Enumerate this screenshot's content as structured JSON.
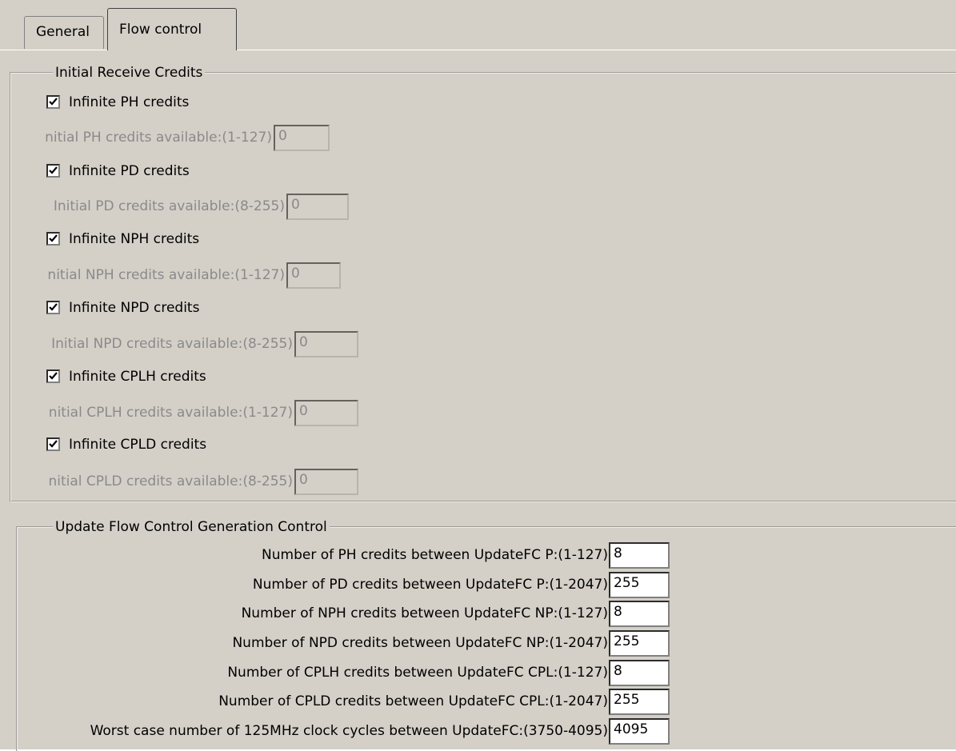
{
  "tabs": [
    {
      "label": "General"
    },
    {
      "label": "Flow control"
    }
  ],
  "initial_credits": {
    "legend": "Initial Receive Credits",
    "rows": [
      {
        "checkbox_label": "Infinite PH credits",
        "checked": true,
        "field_label": "nitial PH credits available:(1-127)",
        "value": "0"
      },
      {
        "checkbox_label": "Infinite PD credits",
        "checked": true,
        "field_label": "Initial PD credits available:(8-255)",
        "value": "0"
      },
      {
        "checkbox_label": "Infinite NPH credits",
        "checked": true,
        "field_label": "nitial NPH credits available:(1-127)",
        "value": "0"
      },
      {
        "checkbox_label": "Infinite NPD credits",
        "checked": true,
        "field_label": "Initial NPD credits available:(8-255)",
        "value": "0"
      },
      {
        "checkbox_label": "Infinite CPLH credits",
        "checked": true,
        "field_label": "nitial CPLH credits available:(1-127)",
        "value": "0"
      },
      {
        "checkbox_label": "Infinite CPLD credits",
        "checked": true,
        "field_label": "nitial CPLD credits available:(8-255)",
        "value": "0"
      }
    ]
  },
  "update_fc": {
    "legend": "Update Flow Control Generation Control",
    "rows": [
      {
        "label": "Number of PH credits between UpdateFC P:(1-127)",
        "value": "8"
      },
      {
        "label": "Number of PD credits between UpdateFC P:(1-2047)",
        "value": "255"
      },
      {
        "label": "Number of NPH credits between UpdateFC NP:(1-127)",
        "value": "8"
      },
      {
        "label": "Number of NPD credits between UpdateFC NP:(1-2047)",
        "value": "255"
      },
      {
        "label": "Number of CPLH credits between UpdateFC CPL:(1-127)",
        "value": "8"
      },
      {
        "label": "Number of CPLD credits between UpdateFC CPL:(1-2047)",
        "value": "255"
      },
      {
        "label": "Worst case number of 125MHz clock cycles between UpdateFC:(3750-4095)",
        "value": "4095"
      }
    ]
  }
}
